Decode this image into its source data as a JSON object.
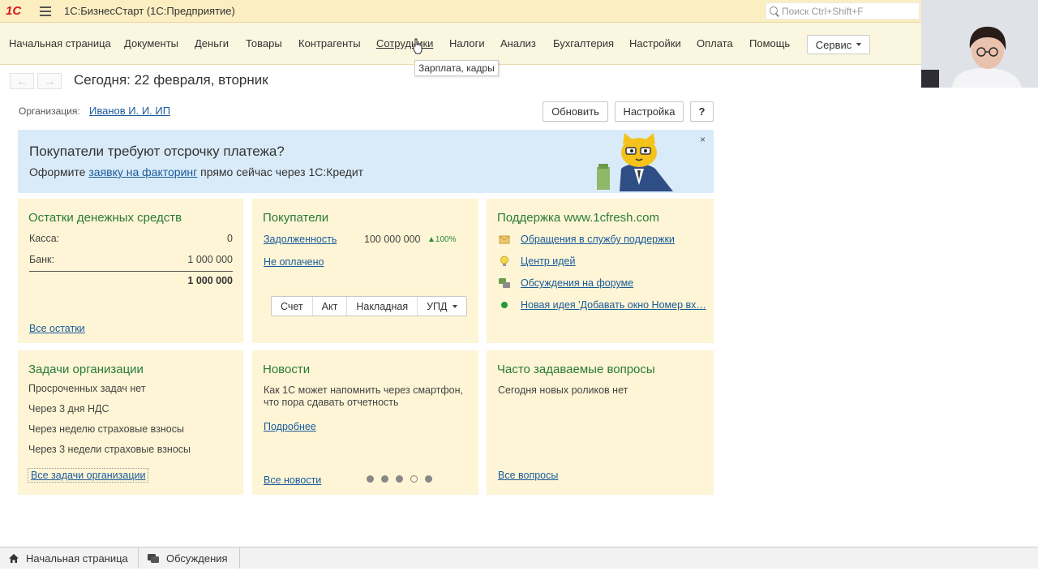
{
  "titlebar": {
    "logo": "1С",
    "app_title": "1С:БизнесСтарт  (1С:Предприятие)",
    "search_placeholder": "Поиск Ctrl+Shift+F"
  },
  "menu": {
    "items": [
      "Начальная страница",
      "Документы",
      "Деньги",
      "Товары",
      "Контрагенты",
      "Сотрудники",
      "Налоги",
      "Анализ",
      "Бухгалтерия",
      "Настройки",
      "Оплата",
      "Помощь"
    ],
    "service_label": "Сервис",
    "tooltip": "Зарплата, кадры"
  },
  "page": {
    "back": "←",
    "forward": "→",
    "title": "Сегодня: 22 февраля, вторник",
    "org_label": "Организация:",
    "org_value": "Иванов И. И. ИП",
    "refresh_label": "Обновить",
    "settings_label": "Настройка",
    "help_label": "?"
  },
  "banner": {
    "title": "Покупатели требуют отсрочку платежа?",
    "text_before": "Оформите ",
    "text_link": "заявку на факторинг",
    "text_after": " прямо сейчас через 1С:Кредит",
    "close": "×"
  },
  "cash": {
    "title": "Остатки денежных средств",
    "rows": [
      {
        "label": "Касса:",
        "value": "0"
      },
      {
        "label": "Банк:",
        "value": "1 000 000"
      }
    ],
    "total": "1 000 000",
    "all_link": "Все остатки"
  },
  "buyers": {
    "title": "Покупатели",
    "debt_label": "Задолженность",
    "debt_value": "100 000 000",
    "debt_change": "▲100%",
    "unpaid_link": "Не оплачено",
    "doc_buttons": [
      "Счет",
      "Акт",
      "Накладная",
      "УПД"
    ]
  },
  "support": {
    "title": "Поддержка www.1cfresh.com",
    "links": [
      "Обращения в службу поддержки",
      "Центр идей",
      "Обсуждения на форуме",
      "Новая идея 'Добавать окно Номер вх…"
    ],
    "icons": [
      "envelope-icon",
      "lightbulb-icon",
      "forum-icon",
      "green-dot-icon"
    ]
  },
  "tasks": {
    "title": "Задачи организации",
    "items": [
      "Просроченных задач нет",
      "Через 3 дня НДС",
      "Через неделю страховые взносы",
      "Через 3 недели страховые взносы"
    ],
    "all_link": "Все задачи организации"
  },
  "news": {
    "title": "Новости",
    "text": "Как 1С может напомнить через смартфон, что пора сдавать отчетность",
    "more_link": "Подробнее",
    "all_link": "Все новости",
    "carousel_dots": 5,
    "carousel_active_index": 3
  },
  "faq": {
    "title": "Часто задаваемые вопросы",
    "text": "Сегодня новых роликов нет",
    "all_link": "Все вопросы"
  },
  "bottom": {
    "tabs": [
      "Начальная страница",
      "Обсуждения"
    ]
  },
  "colors": {
    "titlebar": "#fbeec1",
    "menubar": "#fbf6df",
    "card": "#fdf5d5",
    "banner": "#d9ebf8",
    "card_title": "#2a7a3c",
    "link": "#1a5a9c",
    "up": "#2a8a3c"
  }
}
